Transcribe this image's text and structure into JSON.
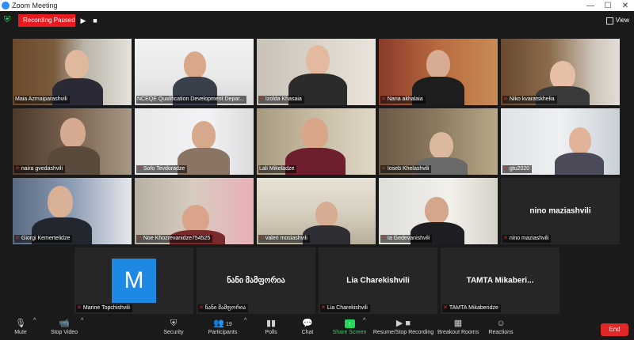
{
  "window": {
    "title": "Zoom Meeting"
  },
  "topbar": {
    "recording_status": "Recording Paused",
    "view_label": "View"
  },
  "gallery": {
    "tiles": [
      {
        "name": "Maia Azmaiparashvili",
        "muted": false
      },
      {
        "name": "NCEQE Qualification Development Depar...",
        "muted": false
      },
      {
        "name": "Izolda Khasaia",
        "muted": true
      },
      {
        "name": "Nana akhalaia",
        "muted": true
      },
      {
        "name": "Niko kvaratskhelia",
        "muted": true
      },
      {
        "name": "naira gvedashvili",
        "muted": true
      },
      {
        "name": "Sofo Tevdoradze",
        "muted": true
      },
      {
        "name": "Lali Mikeladze",
        "muted": false
      },
      {
        "name": "Ioseb Khelashvili",
        "muted": true
      },
      {
        "name": "gtu2020",
        "muted": true
      },
      {
        "name": "Giorgi Kemertelidze",
        "muted": true
      },
      {
        "name": "Noe Khozrevanidze754525",
        "muted": true
      },
      {
        "name": "valeri mosiashvili",
        "muted": true
      },
      {
        "name": "Ia Gedevanishvili",
        "muted": true
      },
      {
        "name": "nino maziashvili",
        "muted": true,
        "center_name": "nino maziashvili"
      },
      {
        "name": "Marine Topchishvili",
        "muted": true,
        "avatar_letter": "M"
      },
      {
        "name": "ნანი მამფორია",
        "muted": true,
        "center_name": "ნანი მამფორია"
      },
      {
        "name": "Lia Charekishvili",
        "muted": true,
        "center_name": "Lia Charekishvili"
      },
      {
        "name": "TAMTA Mikaberidze",
        "muted": true,
        "center_name": "TAMTA  Mikaberi..."
      }
    ]
  },
  "toolbar": {
    "mute": "Mute",
    "stop_video": "Stop Video",
    "security": "Security",
    "participants": "Participants",
    "participants_count": "19",
    "polls": "Polls",
    "chat": "Chat",
    "share_screen": "Share Screen",
    "recording": "Resume/Stop Recording",
    "breakout": "Breakout Rooms",
    "reactions": "Reactions",
    "end": "End"
  },
  "colors": {
    "recording_red": "#e8191f",
    "share_green": "#23d959",
    "active_speaker": "#98c93c",
    "end_red": "#e02828",
    "avatar_blue": "#1e88e5"
  }
}
